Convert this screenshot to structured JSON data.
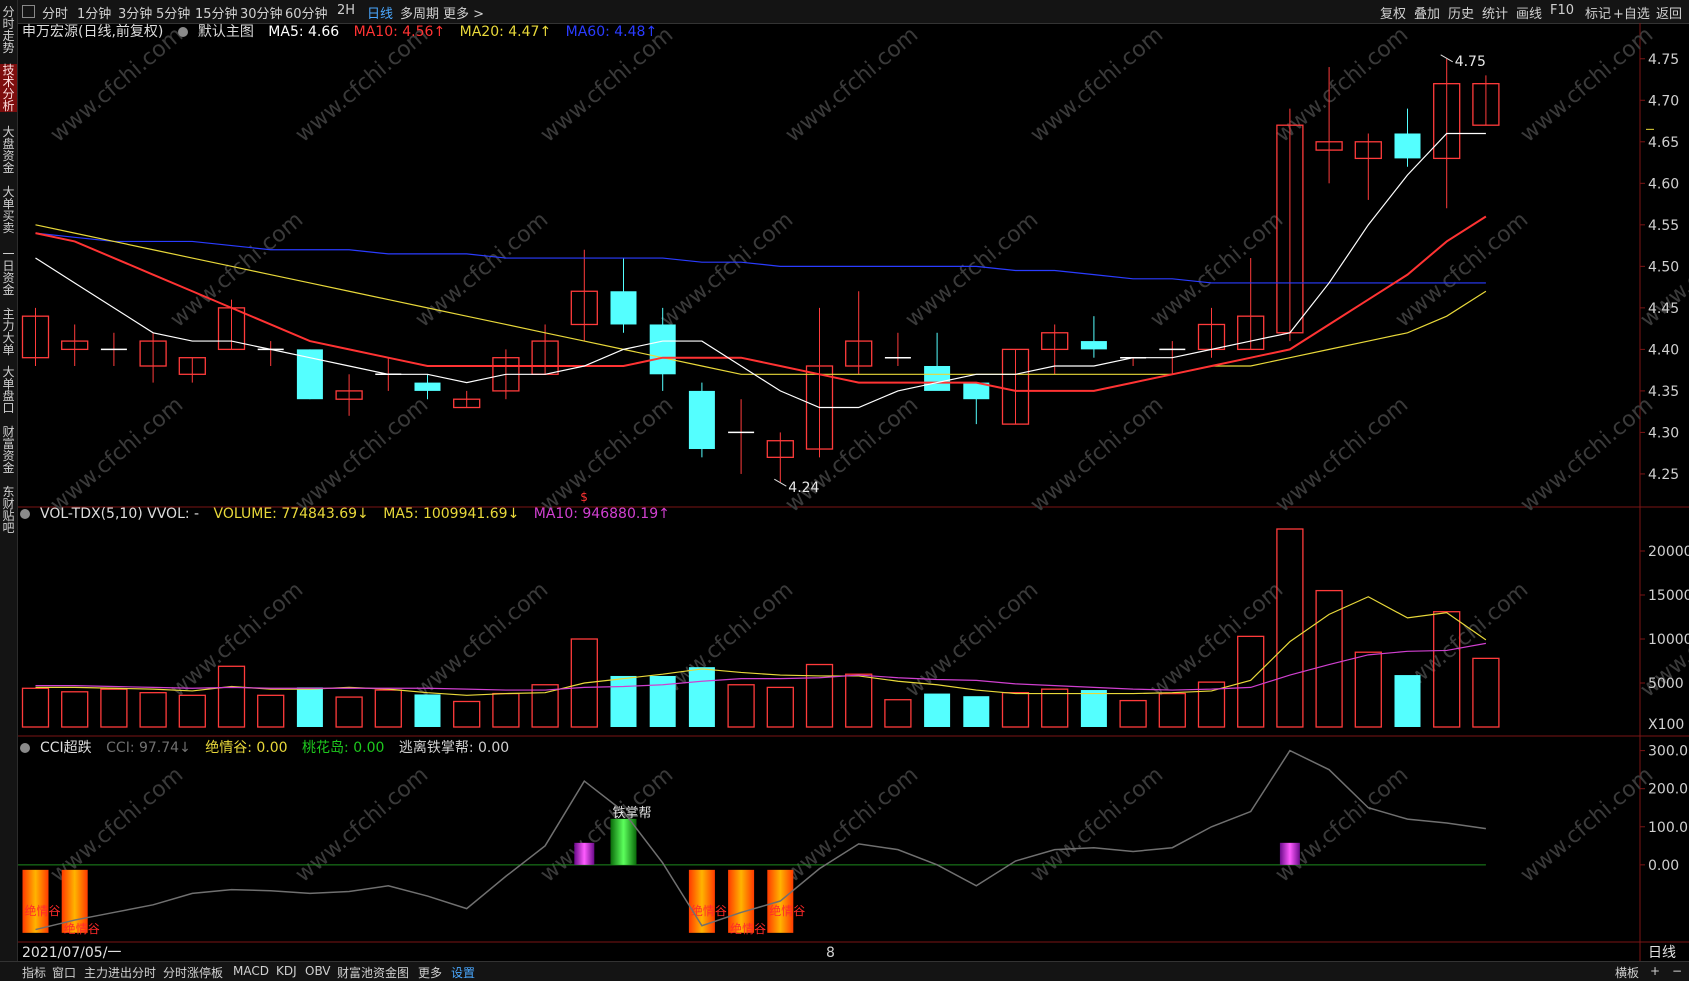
{
  "toolbar": {
    "tabs": [
      "分时",
      "1分钟",
      "3分钟",
      "5分钟",
      "15分钟",
      "30分钟",
      "60分钟",
      "2H",
      "日线",
      "多周期",
      "更多 >"
    ],
    "active_tab": "日线",
    "right_tabs": [
      "复权",
      "叠加",
      "历史",
      "统计",
      "画线",
      "F10",
      "标记",
      "+自选",
      "返回"
    ]
  },
  "sidebar": {
    "items": [
      "分时走势",
      "技术分析",
      "大盘资金",
      "大单买卖",
      "一日资金",
      "主力大单",
      "大单盘口",
      "财富资金",
      "东财贴吧"
    ],
    "active": "技术分析"
  },
  "main_legend": {
    "stock": "申万宏源(日线,前复权)",
    "template": "默认主图",
    "ma5": "MA5: 4.66",
    "ma10": "MA10: 4.56↑",
    "ma20": "MA20: 4.47↑",
    "ma60": "MA60: 4.48↑",
    "colors": {
      "ma5": "#ffffff",
      "ma10": "#ff3333",
      "ma20": "#e8d83a",
      "ma60": "#2a3cff"
    }
  },
  "vol_legend": {
    "name": "VOL-TDX(5,10) VVOL: -",
    "volume": "VOLUME: 774843.69↓",
    "ma5": "MA5: 1009941.69↓",
    "ma10": "MA10: 946880.19↑",
    "colors": {
      "volume": "#e8d83a",
      "ma5": "#e8d83a",
      "ma10": "#d040d0"
    }
  },
  "cci_legend": {
    "name": "CCI超跌",
    "cci": "CCI: 97.74↓",
    "jqg": "绝情谷: 0.00",
    "thd": "桃花岛: 0.00",
    "tlz": "逃离铁掌帮: 0.00",
    "colors": {
      "cci": "#707070",
      "jqg": "#e8d83a",
      "thd": "#1ec81e",
      "tlz": "#d0d0d0"
    }
  },
  "bottom_bar": {
    "date": "2021/07/05/一",
    "center_value": "8",
    "period": "日线",
    "tabs": [
      "指标",
      "窗口",
      "主力进出分时",
      "分时涨停板",
      "MACD",
      "KDJ",
      "OBV",
      "财富池资金图",
      "更多",
      "设置"
    ],
    "active_tab": "设置",
    "right_tabs": [
      "横板",
      "+",
      "−"
    ]
  },
  "chart_data": [
    {
      "type": "candlestick",
      "title": "申万宏源(日线,前复权)",
      "y_ticks": [
        "4.75",
        "4.70",
        "4.65",
        "4.60",
        "4.55",
        "4.50",
        "4.45",
        "4.40",
        "4.35",
        "4.30",
        "4.25"
      ],
      "ylim": [
        4.215,
        4.775
      ],
      "annotations": {
        "high": "4.75",
        "low": "4.24",
        "marker": "$"
      },
      "candles": [
        {
          "o": 4.39,
          "h": 4.45,
          "l": 4.38,
          "c": 4.44
        },
        {
          "o": 4.4,
          "h": 4.43,
          "l": 4.38,
          "c": 4.41
        },
        {
          "o": 4.4,
          "h": 4.42,
          "l": 4.38,
          "c": 4.4
        },
        {
          "o": 4.38,
          "h": 4.42,
          "l": 4.36,
          "c": 4.41
        },
        {
          "o": 4.37,
          "h": 4.39,
          "l": 4.36,
          "c": 4.39
        },
        {
          "o": 4.4,
          "h": 4.46,
          "l": 4.4,
          "c": 4.45
        },
        {
          "o": 4.4,
          "h": 4.41,
          "l": 4.38,
          "c": 4.4
        },
        {
          "o": 4.4,
          "h": 4.4,
          "l": 4.34,
          "c": 4.34
        },
        {
          "o": 4.34,
          "h": 4.37,
          "l": 4.32,
          "c": 4.35
        },
        {
          "o": 4.37,
          "h": 4.39,
          "l": 4.35,
          "c": 4.37
        },
        {
          "o": 4.36,
          "h": 4.37,
          "l": 4.34,
          "c": 4.35
        },
        {
          "o": 4.33,
          "h": 4.35,
          "l": 4.33,
          "c": 4.34
        },
        {
          "o": 4.35,
          "h": 4.4,
          "l": 4.34,
          "c": 4.39
        },
        {
          "o": 4.37,
          "h": 4.43,
          "l": 4.37,
          "c": 4.41
        },
        {
          "o": 4.43,
          "h": 4.52,
          "l": 4.41,
          "c": 4.47
        },
        {
          "o": 4.47,
          "h": 4.51,
          "l": 4.42,
          "c": 4.43
        },
        {
          "o": 4.43,
          "h": 4.45,
          "l": 4.35,
          "c": 4.37
        },
        {
          "o": 4.35,
          "h": 4.36,
          "l": 4.27,
          "c": 4.28
        },
        {
          "o": 4.3,
          "h": 4.34,
          "l": 4.25,
          "c": 4.3
        },
        {
          "o": 4.27,
          "h": 4.3,
          "l": 4.24,
          "c": 4.29
        },
        {
          "o": 4.28,
          "h": 4.45,
          "l": 4.27,
          "c": 4.38
        },
        {
          "o": 4.38,
          "h": 4.47,
          "l": 4.37,
          "c": 4.41
        },
        {
          "o": 4.39,
          "h": 4.42,
          "l": 4.38,
          "c": 4.39
        },
        {
          "o": 4.38,
          "h": 4.42,
          "l": 4.36,
          "c": 4.35
        },
        {
          "o": 4.36,
          "h": 4.36,
          "l": 4.31,
          "c": 4.34
        },
        {
          "o": 4.31,
          "h": 4.4,
          "l": 4.31,
          "c": 4.4
        },
        {
          "o": 4.4,
          "h": 4.43,
          "l": 4.37,
          "c": 4.42
        },
        {
          "o": 4.41,
          "h": 4.44,
          "l": 4.39,
          "c": 4.4
        },
        {
          "o": 4.39,
          "h": 4.39,
          "l": 4.38,
          "c": 4.39
        },
        {
          "o": 4.4,
          "h": 4.41,
          "l": 4.37,
          "c": 4.4
        },
        {
          "o": 4.4,
          "h": 4.45,
          "l": 4.39,
          "c": 4.43
        },
        {
          "o": 4.4,
          "h": 4.51,
          "l": 4.4,
          "c": 4.44
        },
        {
          "o": 4.42,
          "h": 4.69,
          "l": 4.41,
          "c": 4.67
        },
        {
          "o": 4.64,
          "h": 4.74,
          "l": 4.6,
          "c": 4.65
        },
        {
          "o": 4.63,
          "h": 4.66,
          "l": 4.58,
          "c": 4.65
        },
        {
          "o": 4.66,
          "h": 4.69,
          "l": 4.62,
          "c": 4.63
        },
        {
          "o": 4.63,
          "h": 4.75,
          "l": 4.57,
          "c": 4.72
        },
        {
          "o": 4.67,
          "h": 4.73,
          "l": 4.67,
          "c": 4.72
        }
      ],
      "series": [
        {
          "name": "MA5",
          "color": "#ffffff",
          "values": [
            4.51,
            4.48,
            4.45,
            4.42,
            4.41,
            4.41,
            4.4,
            4.39,
            4.38,
            4.37,
            4.37,
            4.36,
            4.37,
            4.37,
            4.38,
            4.4,
            4.41,
            4.41,
            4.38,
            4.35,
            4.33,
            4.33,
            4.35,
            4.36,
            4.37,
            4.37,
            4.38,
            4.38,
            4.39,
            4.39,
            4.4,
            4.41,
            4.42,
            4.48,
            4.55,
            4.61,
            4.66,
            4.66
          ]
        },
        {
          "name": "MA10",
          "color": "#ff3333",
          "values": [
            4.54,
            4.53,
            4.51,
            4.49,
            4.47,
            4.45,
            4.43,
            4.41,
            4.4,
            4.39,
            4.38,
            4.38,
            4.38,
            4.38,
            4.38,
            4.38,
            4.39,
            4.39,
            4.39,
            4.38,
            4.37,
            4.36,
            4.36,
            4.36,
            4.36,
            4.35,
            4.35,
            4.35,
            4.36,
            4.37,
            4.38,
            4.39,
            4.4,
            4.43,
            4.46,
            4.49,
            4.53,
            4.56
          ]
        },
        {
          "name": "MA20",
          "color": "#e8d83a",
          "values": [
            4.55,
            4.54,
            4.53,
            4.52,
            4.51,
            4.5,
            4.49,
            4.48,
            4.47,
            4.46,
            4.45,
            4.44,
            4.43,
            4.42,
            4.41,
            4.4,
            4.39,
            4.38,
            4.37,
            4.37,
            4.37,
            4.37,
            4.37,
            4.37,
            4.37,
            4.37,
            4.37,
            4.37,
            4.37,
            4.37,
            4.38,
            4.38,
            4.39,
            4.4,
            4.41,
            4.42,
            4.44,
            4.47
          ]
        },
        {
          "name": "MA60",
          "color": "#2a3cff",
          "values": [
            4.54,
            4.535,
            4.53,
            4.53,
            4.53,
            4.525,
            4.52,
            4.52,
            4.52,
            4.515,
            4.515,
            4.515,
            4.51,
            4.51,
            4.51,
            4.51,
            4.51,
            4.505,
            4.505,
            4.5,
            4.5,
            4.5,
            4.5,
            4.5,
            4.5,
            4.495,
            4.495,
            4.49,
            4.485,
            4.485,
            4.48,
            4.48,
            4.48,
            4.48,
            4.48,
            4.48,
            4.48,
            4.48
          ]
        }
      ]
    },
    {
      "type": "bar",
      "title": "VOL-TDX(5,10)",
      "y_ticks": [
        "20000",
        "15000",
        "10000",
        "5000"
      ],
      "y_unit": "X100",
      "ylim": [
        0,
        22500
      ],
      "values": [
        4400,
        4000,
        4300,
        3900,
        3600,
        6900,
        3600,
        4500,
        3400,
        4200,
        3700,
        2900,
        3800,
        4800,
        10000,
        5800,
        5800,
        6800,
        4800,
        4500,
        7100,
        6000,
        3100,
        3800,
        3500,
        3900,
        4300,
        4200,
        3000,
        3800,
        5100,
        10300,
        22500,
        15500,
        8500,
        5900,
        13100,
        7800
      ],
      "series": [
        {
          "name": "MA5",
          "color": "#e8d83a",
          "values": [
            4500,
            4500,
            4400,
            4300,
            4100,
            4600,
            4300,
            4300,
            4500,
            4300,
            3900,
            3600,
            3800,
            3900,
            5000,
            5500,
            6000,
            6600,
            6200,
            5900,
            5800,
            5800,
            5200,
            4800,
            4200,
            3800,
            3800,
            3800,
            3800,
            3900,
            4100,
            5300,
            9700,
            12800,
            14800,
            12400,
            13000,
            9900
          ]
        },
        {
          "name": "MA10",
          "color": "#d040d0",
          "values": [
            4700,
            4700,
            4600,
            4500,
            4400,
            4500,
            4400,
            4400,
            4400,
            4400,
            4400,
            4300,
            4200,
            4200,
            4500,
            4600,
            4800,
            5200,
            5500,
            5500,
            5600,
            5900,
            5600,
            5400,
            5300,
            4900,
            4700,
            4500,
            4300,
            4200,
            4300,
            4500,
            5900,
            7100,
            8200,
            8600,
            8700,
            9500
          ]
        }
      ]
    },
    {
      "type": "line",
      "title": "CCI超跌",
      "y_ticks": [
        "300.0",
        "200.0",
        "100.0",
        "0.00"
      ],
      "ylim": [
        -200,
        320
      ],
      "series": [
        {
          "name": "CCI",
          "color": "#707070",
          "values": [
            -170,
            -145,
            -125,
            -105,
            -75,
            -65,
            -68,
            -75,
            -70,
            -55,
            -82,
            -115,
            -30,
            50,
            220,
            140,
            5,
            -160,
            -125,
            -95,
            -10,
            55,
            40,
            0,
            -55,
            10,
            40,
            45,
            35,
            45,
            100,
            140,
            300,
            250,
            150,
            120,
            110,
            95
          ]
        }
      ],
      "signals": {
        "jqg_label": "绝情谷",
        "jqg_bars": [
          0,
          1,
          17,
          18,
          19
        ],
        "thd_label": "铁掌帮",
        "thd_bars": [
          15
        ],
        "tlz_bars": [
          14,
          32
        ]
      }
    }
  ]
}
